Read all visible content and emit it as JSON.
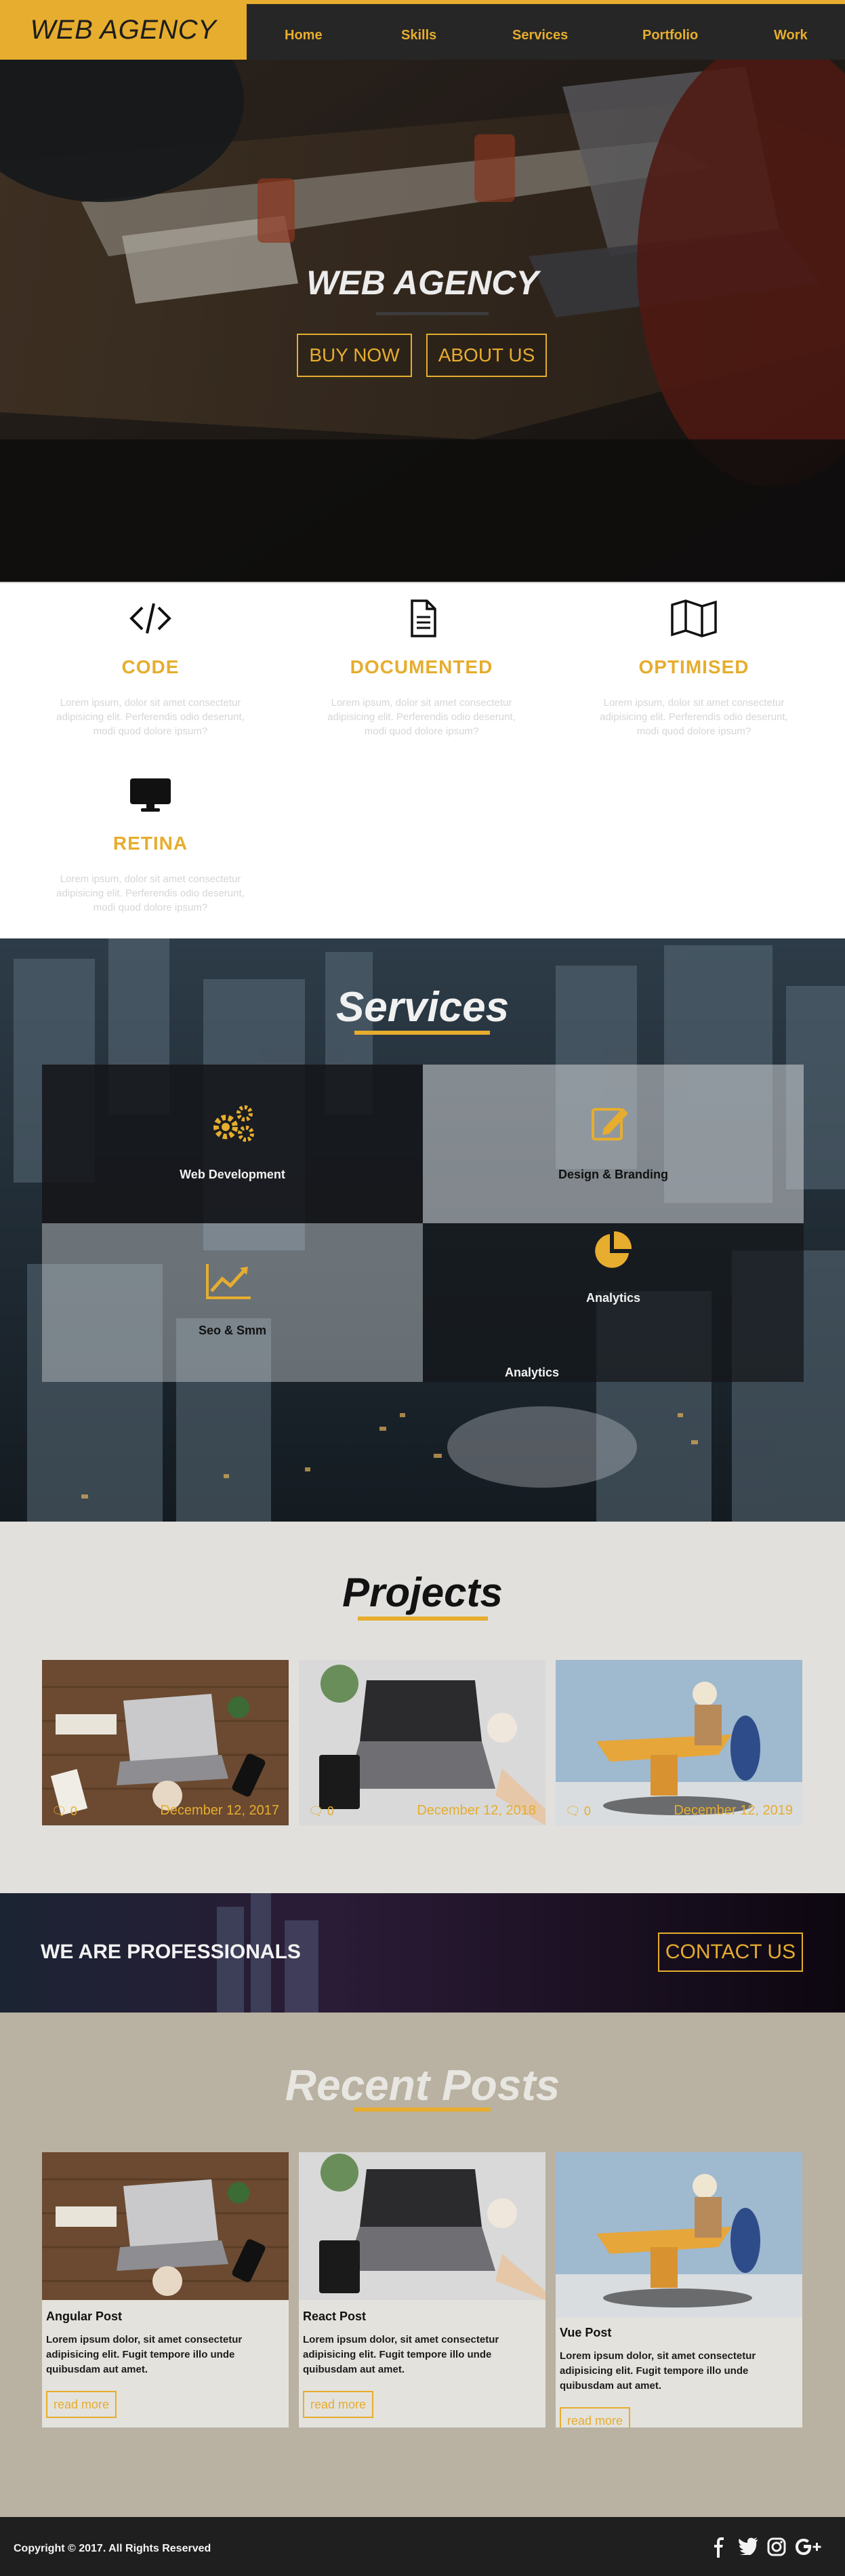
{
  "nav": {
    "logo": "WEB AGENCY",
    "items": [
      "Home",
      "Skills",
      "Services",
      "Portfolio",
      "Work"
    ]
  },
  "hero": {
    "title": "WEB AGENCY",
    "buy_button": "BUY NOW",
    "about_button": "ABOUT US"
  },
  "features": [
    {
      "icon": "code-icon",
      "title": "CODE",
      "text": "Lorem ipsum, dolor sit amet consectetur adipisicing elit. Perferendis odio deserunt, modi quod dolore ipsum?"
    },
    {
      "icon": "document-icon",
      "title": "DOCUMENTED",
      "text": "Lorem ipsum, dolor sit amet consectetur adipisicing elit. Perferendis odio deserunt, modi quod dolore ipsum?"
    },
    {
      "icon": "map-icon",
      "title": "OPTIMISED",
      "text": "Lorem ipsum, dolor sit amet consectetur adipisicing elit. Perferendis odio deserunt, modi quod dolore ipsum?"
    },
    {
      "icon": "desktop-icon",
      "title": "RETINA",
      "text": "Lorem ipsum, dolor sit amet consectetur adipisicing elit. Perferendis odio deserunt, modi quod dolore ipsum?"
    }
  ],
  "services": {
    "title": "Services",
    "tiles": [
      {
        "label": "Web Development",
        "icon": "gears-icon"
      },
      {
        "label": "Design & Branding",
        "icon": "edit-icon"
      },
      {
        "label": "Seo & Smm",
        "icon": "line-chart-icon"
      },
      {
        "label": "Analytics",
        "icon": "pie-chart-icon"
      }
    ],
    "extra_label": "Analytics"
  },
  "projects": {
    "title": "Projects",
    "items": [
      {
        "comments": "0",
        "date": "December 12, 2017"
      },
      {
        "comments": "0",
        "date": "December 12, 2018"
      },
      {
        "comments": "0",
        "date": "December 12, 2019"
      }
    ]
  },
  "professionals": {
    "text": "WE ARE PROFESSIONALS",
    "button": "CONTACT US"
  },
  "posts": {
    "title": "Recent Posts",
    "items": [
      {
        "title": "Angular Post",
        "text": "Lorem ipsum dolor, sit amet consectetur adipisicing elit. Fugit tempore illo unde quibusdam aut amet.",
        "button": "read more"
      },
      {
        "title": "React Post",
        "text": "Lorem ipsum dolor, sit amet consectetur adipisicing elit. Fugit tempore illo unde quibusdam aut amet.",
        "button": "read more"
      },
      {
        "title": "Vue Post",
        "text": "Lorem ipsum dolor, sit amet consectetur adipisicing elit. Fugit tempore illo unde quibusdam aut amet.",
        "button": "read more"
      }
    ]
  },
  "footer": {
    "copyright": "Copyright © 2017. All Rights Reserved",
    "social": [
      "facebook-icon",
      "twitter-icon",
      "instagram-icon",
      "google-plus-icon"
    ]
  },
  "colors": {
    "accent": "#e6ad2e",
    "dark": "#262626"
  }
}
